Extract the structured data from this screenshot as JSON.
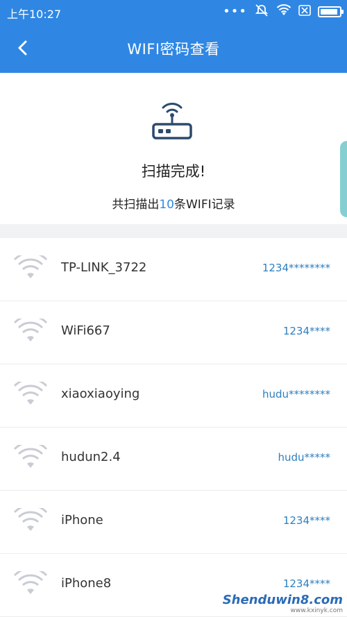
{
  "status_bar": {
    "time": "上午10:27",
    "icons": [
      "more-dots-icon",
      "mute-icon",
      "wifi-icon",
      "close-box-icon",
      "battery-icon"
    ]
  },
  "nav": {
    "title": "WIFI密码查看",
    "back_icon": "chevron-left-icon"
  },
  "header": {
    "icon": "router-icon",
    "scan_title": "扫描完成!",
    "count_prefix": "共扫描出",
    "count_value": "10",
    "count_suffix": "条WIFI记录"
  },
  "networks": [
    {
      "ssid": "TP-LINK_3722",
      "password": "1234********"
    },
    {
      "ssid": "WiFi667",
      "password": "1234****"
    },
    {
      "ssid": "xiaoxiaoying",
      "password": "hudu********"
    },
    {
      "ssid": "hudun2.4",
      "password": "hudu*****"
    },
    {
      "ssid": "iPhone",
      "password": "1234****"
    },
    {
      "ssid": "iPhone8",
      "password": "1234****"
    }
  ],
  "colors": {
    "primary": "#2f87e3",
    "password_text": "#2e7fbf",
    "separator": "#f1f2f4"
  },
  "watermark": {
    "text": "Shenduwin8.com",
    "sub": "www.kxinyk.com"
  }
}
